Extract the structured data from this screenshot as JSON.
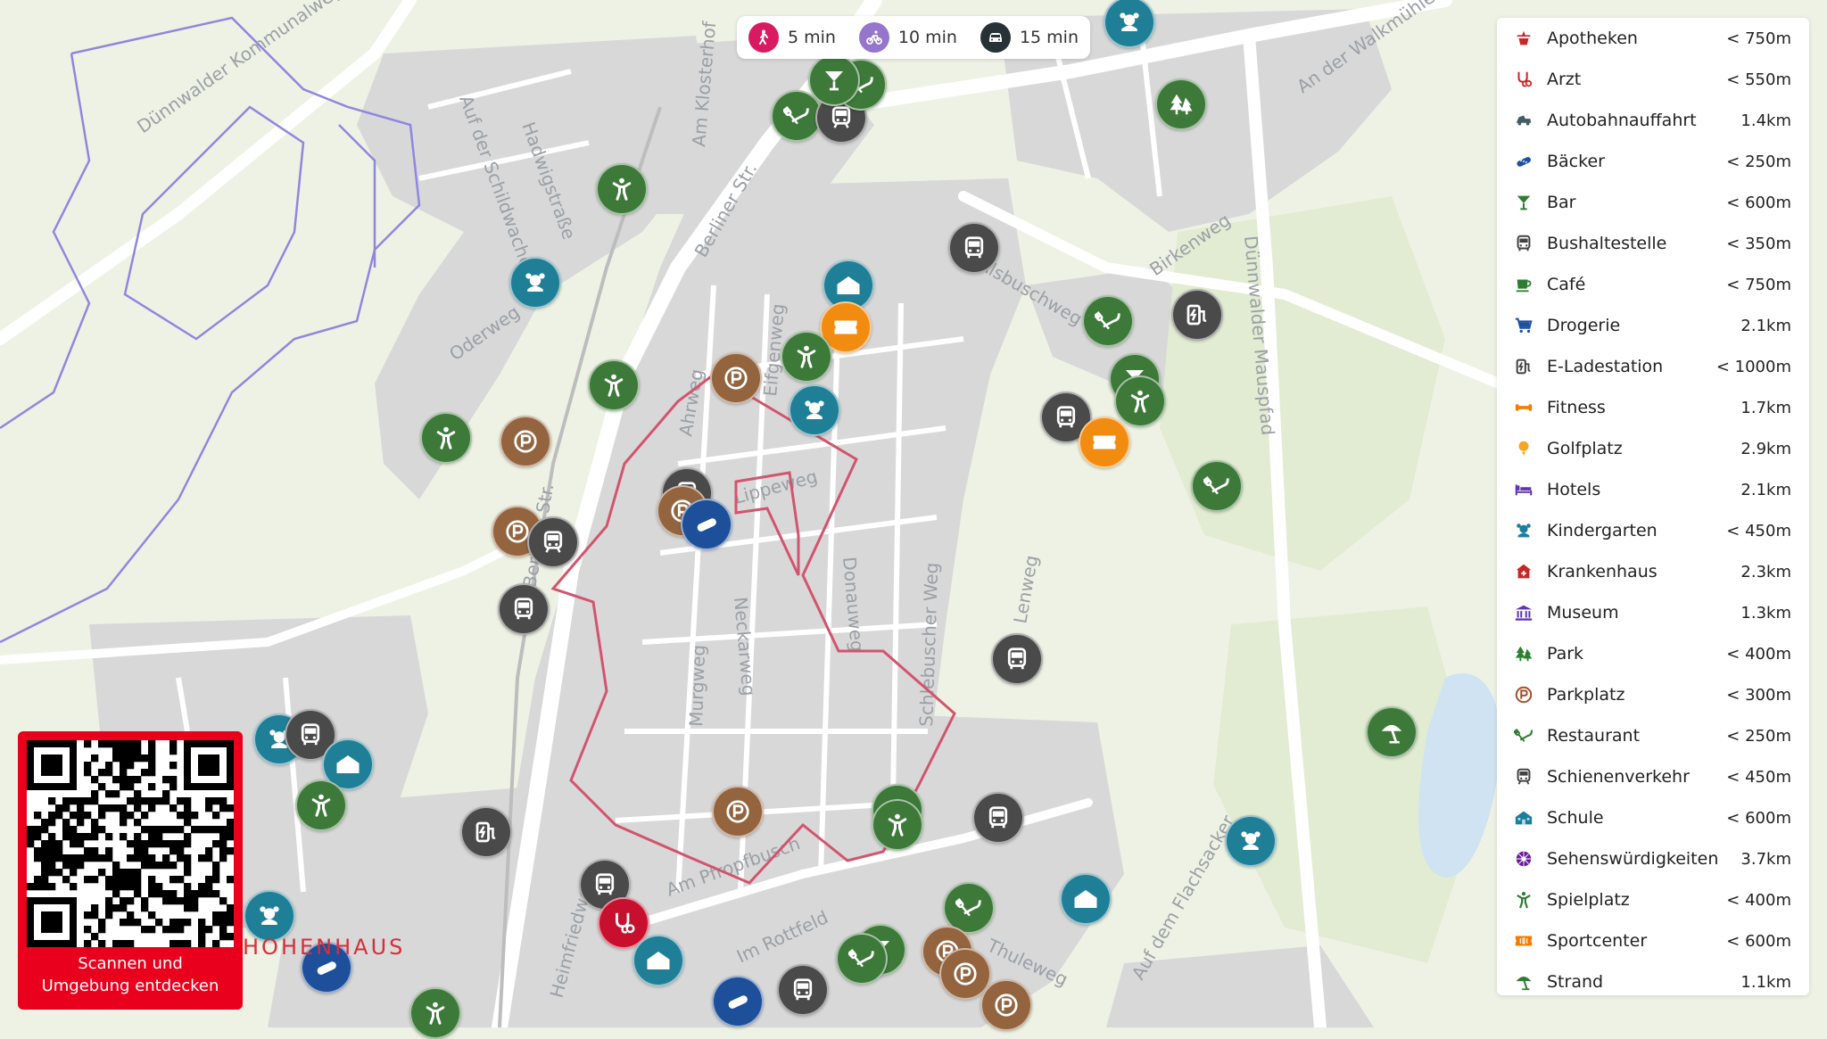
{
  "travel_times": [
    {
      "mode": "walk",
      "icon": "pedestrian-icon",
      "label": "5 min",
      "color": "#d81b60"
    },
    {
      "mode": "bike",
      "icon": "bicycle-icon",
      "label": "10 min",
      "color": "#9575cd"
    },
    {
      "mode": "car",
      "icon": "car-icon",
      "label": "15 min",
      "color": "#263238"
    }
  ],
  "legend": [
    {
      "name": "Apotheken",
      "dist": "< 750m",
      "icon": "pharmacy-icon",
      "color": "#c62828"
    },
    {
      "name": "Arzt",
      "dist": "< 550m",
      "icon": "stethoscope-icon",
      "color": "#c62828"
    },
    {
      "name": "Autobahnauffahrt",
      "dist": "1.4km",
      "icon": "highway-icon",
      "color": "#455a64"
    },
    {
      "name": "Bäcker",
      "dist": "< 250m",
      "icon": "bread-icon",
      "color": "#1e4fa0"
    },
    {
      "name": "Bar",
      "dist": "< 600m",
      "icon": "cocktail-icon",
      "color": "#2e7d32"
    },
    {
      "name": "Bushaltestelle",
      "dist": "< 350m",
      "icon": "bus-icon",
      "color": "#424242"
    },
    {
      "name": "Café",
      "dist": "< 750m",
      "icon": "coffee-icon",
      "color": "#2e7d32"
    },
    {
      "name": "Drogerie",
      "dist": "2.1km",
      "icon": "cart-icon",
      "color": "#1e4fa0"
    },
    {
      "name": "E-Ladestation",
      "dist": "< 1000m",
      "icon": "ev-charger-icon",
      "color": "#424242"
    },
    {
      "name": "Fitness",
      "dist": "1.7km",
      "icon": "dumbbell-icon",
      "color": "#f57c00"
    },
    {
      "name": "Golfplatz",
      "dist": "2.9km",
      "icon": "golf-icon",
      "color": "#f5a623"
    },
    {
      "name": "Hotels",
      "dist": "2.1km",
      "icon": "bed-icon",
      "color": "#5e35b1"
    },
    {
      "name": "Kindergarten",
      "dist": "< 450m",
      "icon": "teddy-icon",
      "color": "#1a7f9c"
    },
    {
      "name": "Krankenhaus",
      "dist": "2.3km",
      "icon": "hospital-icon",
      "color": "#c62828"
    },
    {
      "name": "Museum",
      "dist": "1.3km",
      "icon": "museum-icon",
      "color": "#5e35b1"
    },
    {
      "name": "Park",
      "dist": "< 400m",
      "icon": "trees-icon",
      "color": "#2e7d32"
    },
    {
      "name": "Parkplatz",
      "dist": "< 300m",
      "icon": "parking-icon",
      "color": "#a0522d"
    },
    {
      "name": "Restaurant",
      "dist": "< 250m",
      "icon": "cutlery-icon",
      "color": "#2e7d32"
    },
    {
      "name": "Schienenverkehr",
      "dist": "< 450m",
      "icon": "train-icon",
      "color": "#424242"
    },
    {
      "name": "Schule",
      "dist": "< 600m",
      "icon": "school-icon",
      "color": "#1a7f9c"
    },
    {
      "name": "Sehenswürdigkeiten",
      "dist": "3.7km",
      "icon": "attraction-icon",
      "color": "#6a1b9a"
    },
    {
      "name": "Spielplatz",
      "dist": "< 400m",
      "icon": "playground-icon",
      "color": "#2e7d32"
    },
    {
      "name": "Sportcenter",
      "dist": "< 600m",
      "icon": "ticket-icon",
      "color": "#f57c00"
    },
    {
      "name": "Strand",
      "dist": "1.1km",
      "icon": "umbrella-icon",
      "color": "#2e7d32"
    }
  ],
  "street_names": [
    "Dünnwalder Kommunalweg",
    "Auf der Schildwache",
    "Hadwigstraße",
    "Am Klosterhof",
    "Berliner Str.",
    "Oderweg",
    "Ahrweg",
    "Eifgenweg",
    "Lippeweg",
    "Donauweg",
    "Neckarweg",
    "Murgweg",
    "Schlebuscher Weg",
    "Heimfriedweg",
    "Am Pfropfbusch",
    "Im Rottfeld",
    "Thuleweg",
    "Auf dem Flachsacker",
    "Dünnwalder Mauspfad",
    "Birkenweg",
    "An der Walkmühle",
    "Berliner Str.",
    "Lenweg",
    "Alsbuschweg"
  ],
  "qr_card": {
    "caption_line1": "Scannen und",
    "caption_line2": "Umgebung entdecken"
  },
  "brand_partial": "HOHENHAUS",
  "colors": {
    "restaurant": "#3d7a3a",
    "playground": "#3d7a3a",
    "bus": "#4a4a4a",
    "parking": "#94643f",
    "kindergarten": "#1f7f97",
    "sports": "#f28c10",
    "bakery": "#1d4f9a",
    "doctor": "#c8102e",
    "isochrone": "#d2546e",
    "qr_red": "#e8001c"
  }
}
